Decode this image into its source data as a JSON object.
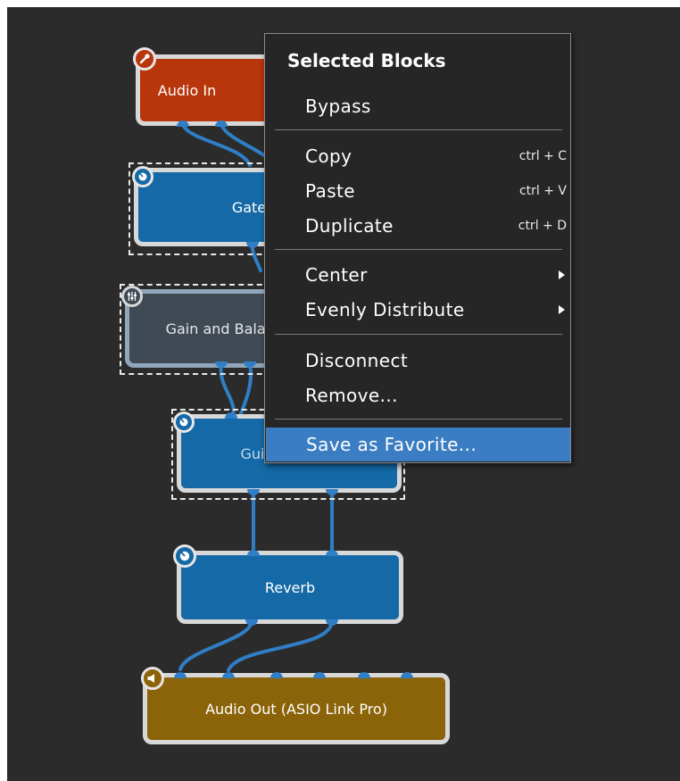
{
  "blocks": {
    "audio_in": {
      "label": "Audio In",
      "icon": "microphone-icon",
      "color": "#b8360b"
    },
    "gate": {
      "label": "Gate",
      "icon": "knob-icon",
      "color": "#1469a6"
    },
    "gain_balance": {
      "label": "Gain and Balance",
      "icon": "mixer-sliders-icon",
      "color": "#3f4a55"
    },
    "guitar_effects": {
      "label": "Guitar Effects",
      "icon": "knob-icon",
      "color": "#1469a6"
    },
    "reverb": {
      "label": "Reverb",
      "icon": "knob-icon",
      "color": "#1469a6"
    },
    "audio_out": {
      "label": "Audio Out (ASIO Link Pro)",
      "icon": "speaker-icon",
      "color": "#8b6309"
    }
  },
  "context_menu": {
    "heading": "Selected Blocks",
    "items": [
      {
        "label": "Bypass",
        "shortcut": ""
      },
      {
        "label": "Copy",
        "shortcut": "ctrl + C"
      },
      {
        "label": "Paste",
        "shortcut": "ctrl + V"
      },
      {
        "label": "Duplicate",
        "shortcut": "ctrl + D"
      },
      {
        "label": "Center",
        "submenu": true
      },
      {
        "label": "Evenly Distribute",
        "submenu": true
      },
      {
        "label": "Disconnect",
        "shortcut": ""
      },
      {
        "label": "Remove...",
        "shortcut": ""
      },
      {
        "label": "Save as Favorite...",
        "shortcut": "",
        "highlighted": true
      }
    ]
  },
  "colors": {
    "canvas": "#2b2b2b",
    "wire": "#2f7ec6",
    "menu_background": "#262626",
    "menu_highlight": "#3b7dc2",
    "selection_outline": "#e8e8e8"
  }
}
